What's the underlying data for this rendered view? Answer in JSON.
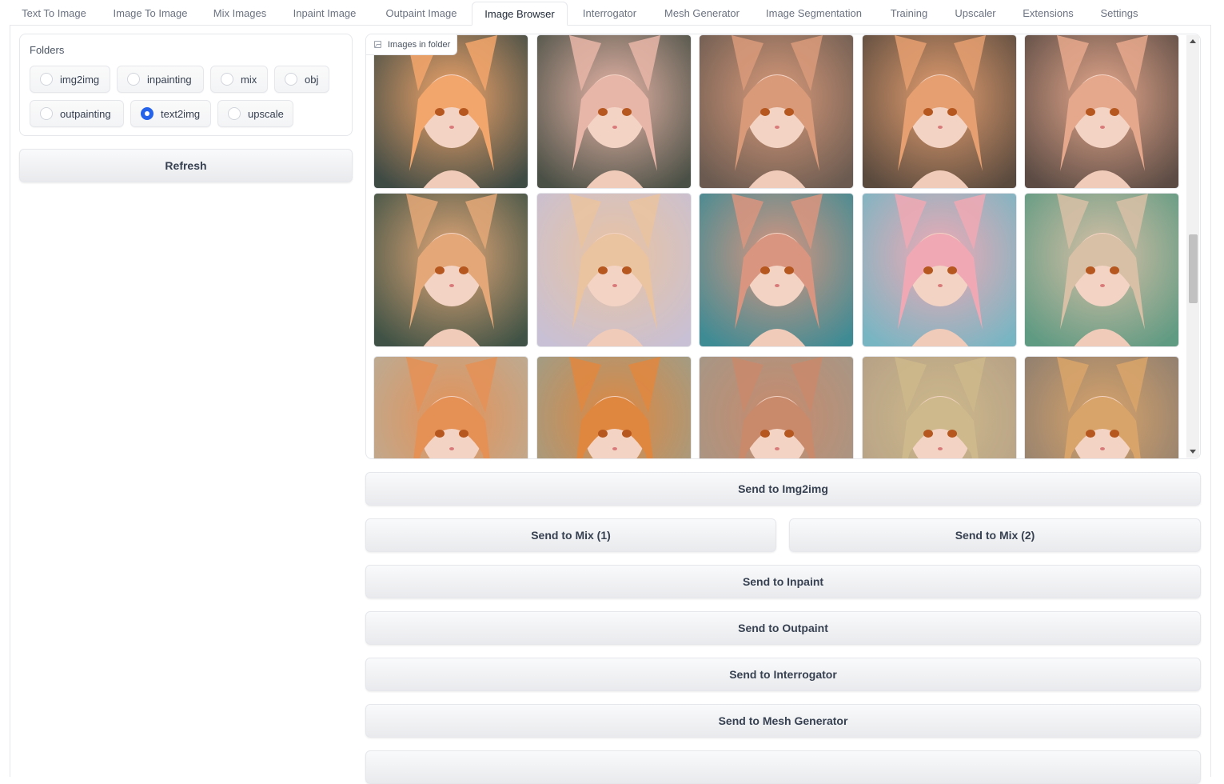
{
  "tabs": [
    {
      "label": "Text To Image"
    },
    {
      "label": "Image To Image"
    },
    {
      "label": "Mix Images"
    },
    {
      "label": "Inpaint Image"
    },
    {
      "label": "Outpaint Image"
    },
    {
      "label": "Image Browser",
      "active": true
    },
    {
      "label": "Interrogator"
    },
    {
      "label": "Mesh Generator"
    },
    {
      "label": "Image Segmentation"
    },
    {
      "label": "Training"
    },
    {
      "label": "Upscaler"
    },
    {
      "label": "Extensions"
    },
    {
      "label": "Settings"
    }
  ],
  "folders": {
    "title": "Folders",
    "options": [
      "img2img",
      "inpainting",
      "mix",
      "obj",
      "outpainting",
      "text2img",
      "upscale"
    ],
    "selected": "text2img"
  },
  "refresh_label": "Refresh",
  "gallery": {
    "label": "Images in folder",
    "accent_colors": [
      "#f3a66b",
      "#e8b6a8",
      "#d99a7a",
      "#e59f70",
      "#e6a88c",
      "#e4a878",
      "#eac3a0",
      "#d9957f",
      "#f0a9b4",
      "#d8c0a6",
      "#e59156",
      "#e0873f",
      "#c98a6c",
      "#cdb98b",
      "#d9a46a"
    ]
  },
  "actions": {
    "send_img2img": "Send to Img2img",
    "send_mix1": "Send to Mix (1)",
    "send_mix2": "Send to Mix (2)",
    "send_inpaint": "Send to Inpaint",
    "send_outpaint": "Send to Outpaint",
    "send_interrogator": "Send to Interrogator",
    "send_mesh": "Send to Mesh Generator"
  }
}
